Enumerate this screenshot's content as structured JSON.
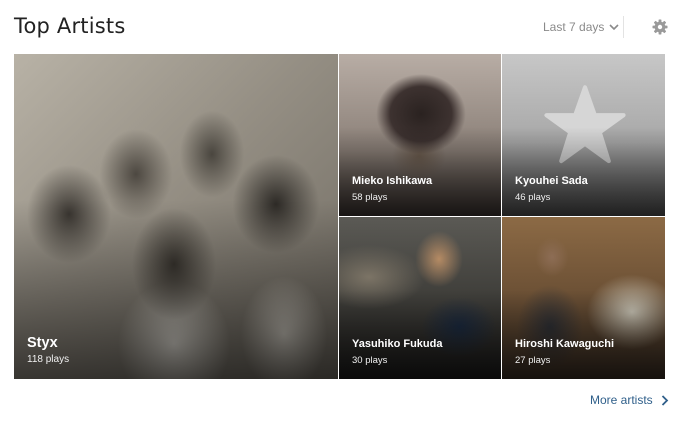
{
  "header": {
    "title": "Top Artists",
    "range_label": "Last 7 days"
  },
  "artists": [
    {
      "name": "Styx",
      "plays": "118 plays"
    },
    {
      "name": "Mieko Ishikawa",
      "plays": "58 plays"
    },
    {
      "name": "Kyouhei Sada",
      "plays": "46 plays"
    },
    {
      "name": "Yasuhiko Fukuda",
      "plays": "30 plays"
    },
    {
      "name": "Hiroshi Kawaguchi",
      "plays": "27 plays"
    }
  ],
  "footer": {
    "more_label": "More artists"
  },
  "colors": {
    "link": "#2f5f8a",
    "muted": "#8a8a8a"
  }
}
